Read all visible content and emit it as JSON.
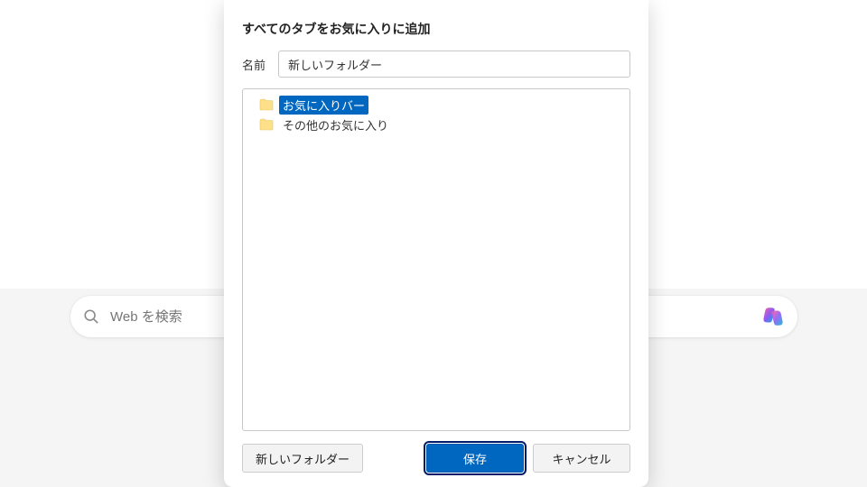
{
  "search": {
    "placeholder": "Web を検索"
  },
  "dialog": {
    "title": "すべてのタブをお気に入りに追加",
    "name_label": "名前",
    "name_value": "新しいフォルダー",
    "tree": [
      {
        "label": "お気に入りバー",
        "selected": true
      },
      {
        "label": "その他のお気に入り",
        "selected": false
      }
    ],
    "buttons": {
      "new_folder": "新しいフォルダー",
      "save": "保存",
      "cancel": "キャンセル"
    }
  }
}
